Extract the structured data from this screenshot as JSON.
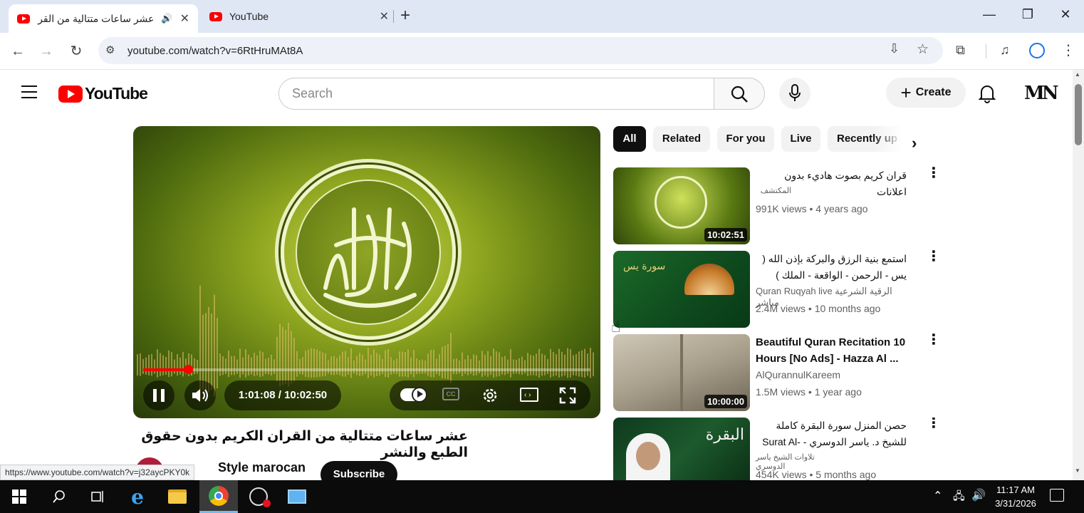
{
  "browser": {
    "tabs": [
      {
        "title": "عشر ساعات متتالية من القران",
        "active": true
      },
      {
        "title": "YouTube",
        "active": false
      }
    ],
    "url": "youtube.com/watch?v=6RtHruMAt8A",
    "status_url": "https://www.youtube.com/watch?v=j32aycPKY0k"
  },
  "youtube": {
    "logo_text": "YouTube",
    "search_placeholder": "Search",
    "create_label": "Create"
  },
  "player": {
    "time_current": "1:01:08",
    "time_separator": " / ",
    "time_total": "10:02:50",
    "progress_fraction": 0.101
  },
  "video": {
    "title": "عشر ساعات متتالية من القران الكريم بدون حقوق الطبع والنشر",
    "channel": "Style marocan",
    "subscribe_label": "Subscribe"
  },
  "chips": [
    "All",
    "Related",
    "For you",
    "Live",
    "Recently up"
  ],
  "recommendations": [
    {
      "title": "قران كريم بصوت هاديء بدون اعلانات",
      "channel": "المكتشف",
      "views": "991K views",
      "age": "4 years ago",
      "duration": "10:02:51",
      "rtl": true
    },
    {
      "title": "استمع بنية الرزق والبركة بإذن الله ( يس - الرحمن - الواقعة - الملك ) الشيخ ماهر ...",
      "channel": "Quran Ruqyah live الرقية الشرعية مباشر",
      "views": "2.4M views",
      "age": "10 months ago",
      "duration": "",
      "rtl": true
    },
    {
      "title": "Beautiful Quran Recitation 10 Hours [No Ads] - Hazza Al ...",
      "channel": "AlQurannulKareem",
      "views": "1.5M views",
      "age": "1 year ago",
      "duration": "10:00:00",
      "rtl": false
    },
    {
      "title": "حصن المنزل سورة البقرة كاملة للشيخ د. ياسر الدوسري - Surat Al-Baqarah",
      "channel": "تلاوات الشيخ ياسر الدوسري",
      "views": "454K views",
      "age": "5 months ago",
      "duration": "",
      "rtl": true
    }
  ],
  "taskbar": {
    "time": "11:17 AM",
    "date": "3/31/2026"
  },
  "colors": {
    "youtube_red": "#ff0000",
    "chrome_tabbar": "#dfe7f5",
    "taskbar": "#0b0b0b"
  }
}
